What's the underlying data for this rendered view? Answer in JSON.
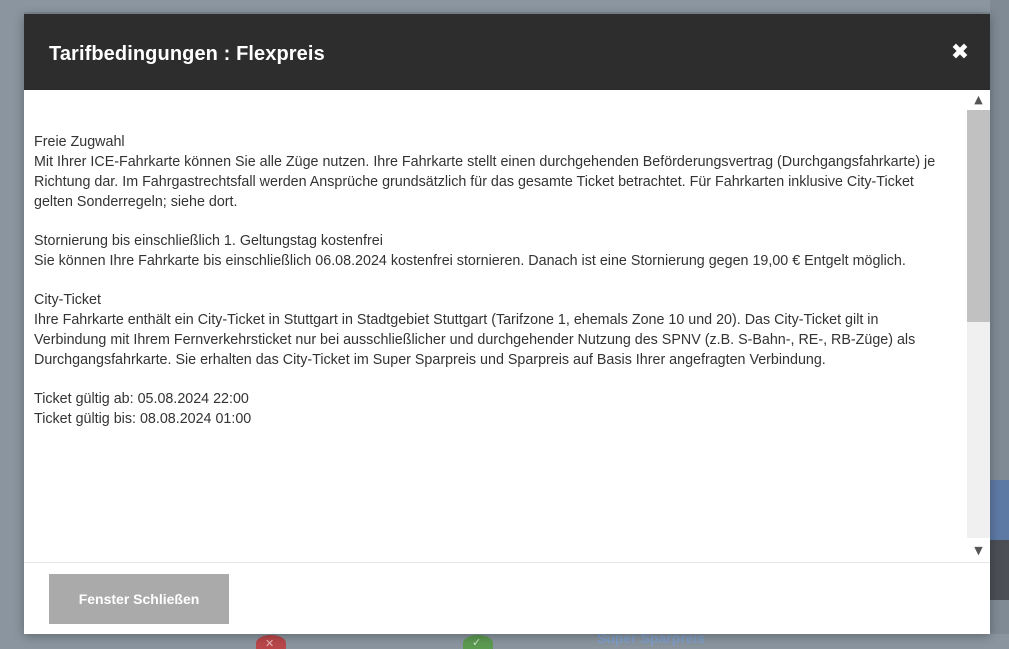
{
  "modal": {
    "title": "Tarifbedingungen : Flexpreis",
    "close_icon": "close-icon",
    "footer_button": "Fenster Schließen"
  },
  "sections": [
    {
      "heading": "Freie Zugwahl",
      "text": "Mit Ihrer ICE-Fahrkarte können Sie alle Züge nutzen. Ihre Fahrkarte stellt einen durchgehenden Beförderungsvertrag (Durchgangsfahrkarte) je Richtung dar. Im Fahrgastrechtsfall werden Ansprüche grundsätzlich für das gesamte Ticket betrachtet. Für Fahrkarten inklusive City-Ticket gelten Sonderregeln; siehe dort."
    },
    {
      "heading": "Stornierung bis einschließlich 1. Geltungstag kostenfrei",
      "text": "Sie können Ihre Fahrkarte bis einschließlich 06.08.2024 kostenfrei stornieren. Danach ist eine Stornierung gegen 19,00 € Entgelt möglich."
    },
    {
      "heading": "City-Ticket",
      "text": "Ihre Fahrkarte enthält ein City-Ticket in Stuttgart in Stadtgebiet Stuttgart (Tarifzone 1, ehemals Zone 10 und 20). Das City-Ticket gilt in Verbindung mit Ihrem Fernverkehrsticket nur bei ausschließlicher und durchgehender Nutzung des SPNV (z.B. S-Bahn-, RE-, RB-Züge) als Durchgangsfahrkarte. Sie erhalten das City-Ticket im Super Sparpreis und Sparpreis auf Basis Ihrer angefragten Verbindung."
    }
  ],
  "validity": {
    "from": "Ticket gültig ab: 05.08.2024 22:00",
    "to": "Ticket gültig bis: 08.08.2024 01:00"
  },
  "background": {
    "label": "Super Sparpreis"
  }
}
